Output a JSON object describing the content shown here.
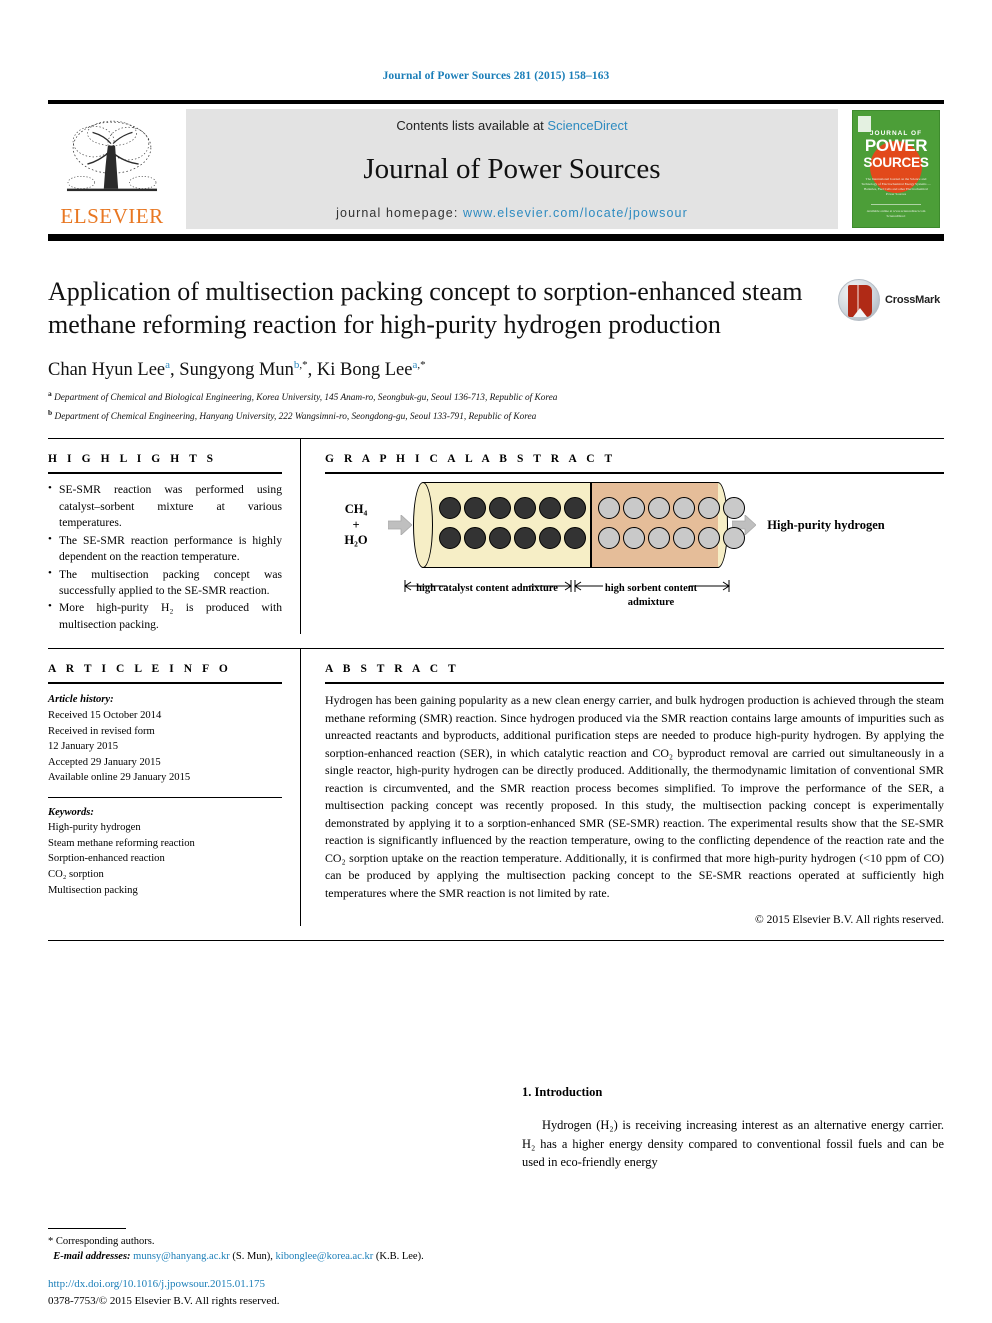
{
  "running_head": "Journal of Power Sources 281 (2015) 158–163",
  "masthead": {
    "publisher_word": "ELSEVIER",
    "contents_prefix": "Contents lists available at ",
    "contents_link": "ScienceDirect",
    "journal_name": "Journal of Power Sources",
    "homepage_prefix": "journal homepage: ",
    "homepage_url": "www.elsevier.com/locate/jpowsour",
    "cover": {
      "journal_of": "JOURNAL OF",
      "power": "POWER",
      "sources": "SOURCES",
      "blurb": "The International Journal on the Science and Technology of Electrochemical Energy Systems — Batteries, Fuel Cells and other Electrochemical Power Sources",
      "foot": "Available online at www.sciencedirect.com  ScienceDirect"
    }
  },
  "title": "Application of multisection packing concept to sorption-enhanced steam methane reforming reaction for high-purity hydrogen production",
  "crossmark_label": "CrossMark",
  "authors": [
    {
      "name": "Chan Hyun Lee",
      "aff": "a",
      "star": false
    },
    {
      "name": "Sungyong Mun",
      "aff": "b",
      "star": true
    },
    {
      "name": "Ki Bong Lee",
      "aff": "a",
      "star": true
    }
  ],
  "affiliations": [
    {
      "marker": "a",
      "text": "Department of Chemical and Biological Engineering, Korea University, 145 Anam-ro, Seongbuk-gu, Seoul 136-713, Republic of Korea"
    },
    {
      "marker": "b",
      "text": "Department of Chemical Engineering, Hanyang University, 222 Wangsimni-ro, Seongdong-gu, Seoul 133-791, Republic of Korea"
    }
  ],
  "highlights": {
    "heading": "H I G H L I G H T S",
    "items": [
      "SE-SMR reaction was performed using catalyst–sorbent mixture at various temperatures.",
      "The SE-SMR reaction performance is highly dependent on the reaction temperature.",
      "The multisection packing concept was successfully applied to the SE-SMR reaction.",
      "More high-purity H₂ is produced with multisection packing."
    ]
  },
  "graphical_abstract": {
    "heading": "G R A P H I C A L   A B S T R A C T",
    "inlet_line1": "CH₄",
    "inlet_line2": "+",
    "inlet_line3": "H₂O",
    "outlet": "High-purity hydrogen",
    "left_section_label": "high catalyst content admixture",
    "right_section_label": "high sorbent content admixture",
    "left_section_color": "#f6eec6",
    "right_section_color": "#e5bd99",
    "catalyst_pellet_color": "#333333",
    "sorbent_pellet_color": "#c9c9c9",
    "catalyst_pellet_count": 12,
    "sorbent_pellet_count": 12
  },
  "article_info": {
    "heading": "A R T I C L E   I N F O",
    "history_label": "Article history:",
    "history": [
      "Received 15 October 2014",
      "Received in revised form",
      "12 January 2015",
      "Accepted 29 January 2015",
      "Available online 29 January 2015"
    ],
    "keywords_label": "Keywords:",
    "keywords": [
      "High-purity hydrogen",
      "Steam methane reforming reaction",
      "Sorption-enhanced reaction",
      "CO₂ sorption",
      "Multisection packing"
    ]
  },
  "abstract": {
    "heading": "A B S T R A C T",
    "paragraph1": "Hydrogen has been gaining popularity as a new clean energy carrier, and bulk hydrogen production is achieved through the steam methane reforming (SMR) reaction. Since hydrogen produced via the SMR reaction contains large amounts of impurities such as unreacted reactants and byproducts, additional purification steps are needed to produce high-purity hydrogen. By applying the sorption-enhanced reaction (SER), in which catalytic reaction and CO₂ byproduct removal are carried out simultaneously in a single reactor, high-purity hydrogen can be directly produced. Additionally, the thermodynamic limitation of conventional SMR reaction is circumvented, and the SMR reaction process becomes simplified. To improve the performance of the SER, a multisection packing concept was recently proposed. In this study, the multisection packing concept is experimentally demonstrated by applying it to a sorption-enhanced SMR (SE-SMR) reaction. The experimental results show that the SE-SMR reaction is significantly influenced by the reaction temperature, owing to the conflicting dependence of the reaction rate and the CO₂ sorption uptake on the reaction temperature. Additionally, it is confirmed that more high-purity hydrogen (<10 ppm of CO) can be produced by applying the multisection packing concept to the SE-SMR reactions operated at sufficiently high temperatures where the SMR reaction is not limited by rate.",
    "copyright": "© 2015 Elsevier B.V. All rights reserved."
  },
  "footnotes": {
    "corresponding": "* Corresponding authors.",
    "email_label": "E-mail addresses:",
    "email1": "munsy@hanyang.ac.kr",
    "email1_owner": "(S. Mun),",
    "email2": "kibonglee@korea.ac.kr",
    "email2_owner": "(K.B. Lee).",
    "doi": "http://dx.doi.org/10.1016/j.jpowsour.2015.01.175",
    "issn_line": "0378-7753/© 2015 Elsevier B.V. All rights reserved."
  },
  "introduction": {
    "heading": "1. Introduction",
    "paragraph": "Hydrogen (H₂) is receiving increasing interest as an alternative energy carrier. H₂ has a higher energy density compared to conventional fossil fuels and can be used in eco-friendly energy"
  },
  "colors": {
    "link_blue": "#1b7eb8",
    "elsevier_orange": "#e87722",
    "cover_green": "#4c9e38",
    "cover_sun": "#e2491b",
    "band_gray": "#e3e3e3"
  }
}
